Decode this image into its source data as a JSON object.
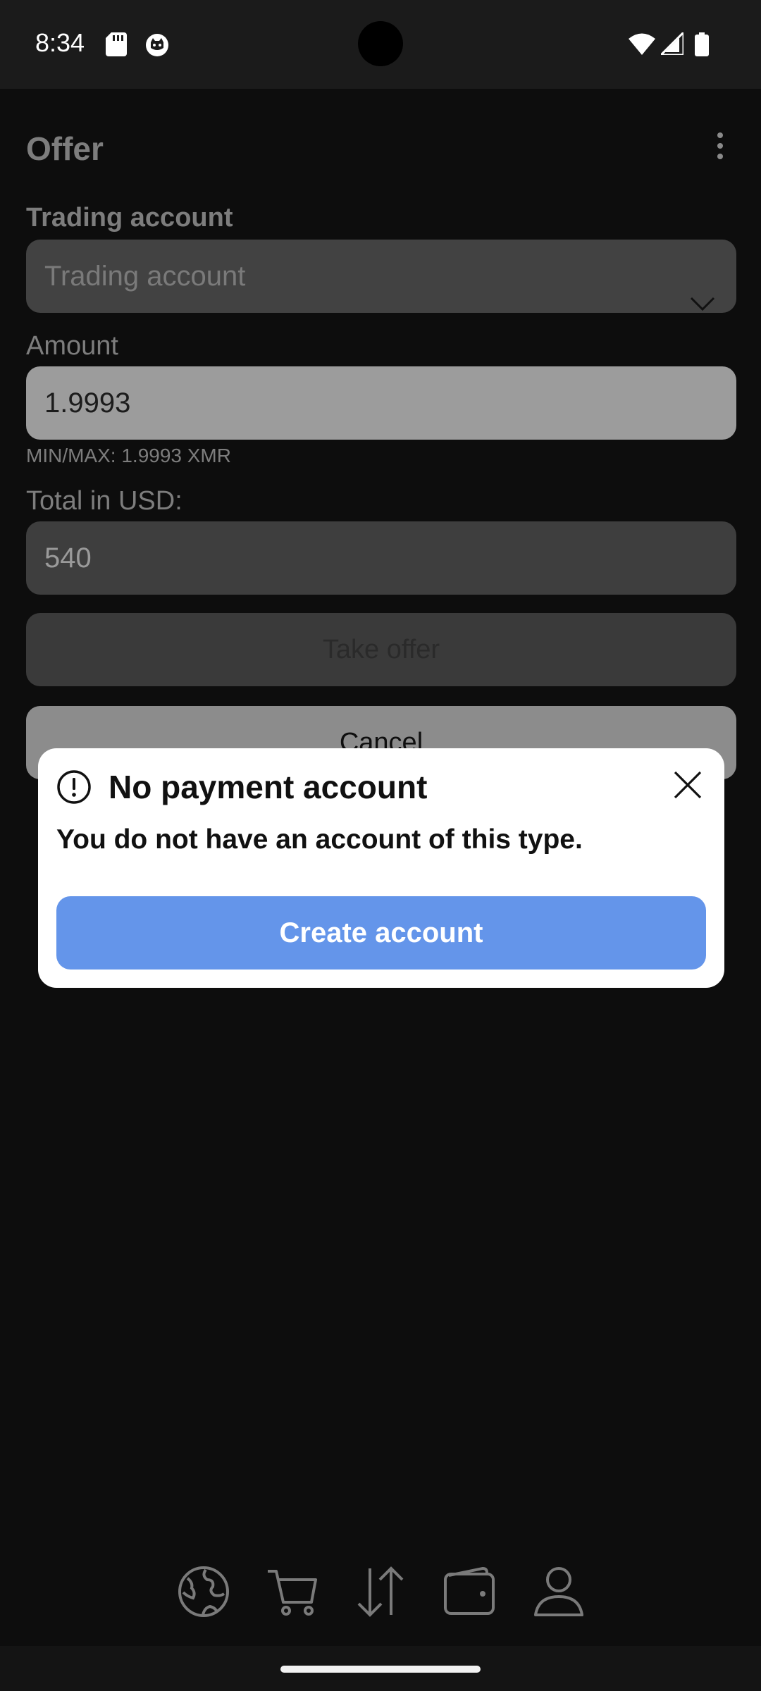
{
  "status_bar": {
    "time": "8:34"
  },
  "header": {
    "title": "Offer"
  },
  "form": {
    "trading_account_label": "Trading account",
    "trading_account_placeholder": "Trading account",
    "amount_label": "Amount",
    "amount_value": "1.9993",
    "amount_helper": "MIN/MAX: 1.9993 XMR",
    "total_label": "Total in USD:",
    "total_value": "540",
    "take_offer_label": "Take offer",
    "cancel_label": "Cancel"
  },
  "dialog": {
    "title": "No payment account",
    "message": "You do not have an account of this type.",
    "create_label": "Create account"
  },
  "bottom_nav": {
    "items": [
      {
        "icon": "globe-icon"
      },
      {
        "icon": "cart-icon"
      },
      {
        "icon": "transfer-icon"
      },
      {
        "icon": "wallet-icon"
      },
      {
        "icon": "profile-icon"
      }
    ]
  }
}
